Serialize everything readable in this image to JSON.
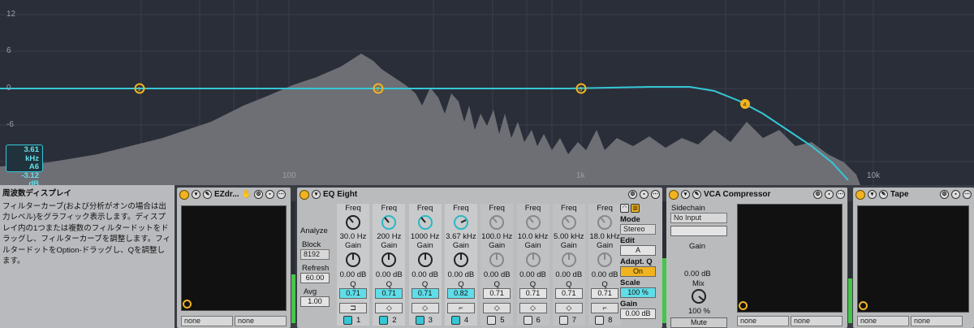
{
  "eq_display": {
    "db_labels": [
      "12",
      "6",
      "0",
      "-6"
    ],
    "freq_labels": [
      "100",
      "1k",
      "10k"
    ],
    "readout": {
      "freq": "3.61 kHz",
      "note": "A6",
      "gain": "-3.12 dB"
    },
    "points": [
      "1",
      "2",
      "3",
      "4"
    ]
  },
  "info": {
    "title": "周波数ディスプレイ",
    "body": "フィルターカーブ(および分析がオンの場合は出力レベル)をグラフィック表示します。ディスプレイ内の1つまたは複数のフィルタードットをドラッグし、フィルターカーブを調整します。フィルタードットをOption-ドラッグし、Qを調整します。"
  },
  "ezdrummer": {
    "name": "EZdr...",
    "routing": [
      "none",
      "none"
    ]
  },
  "eq_eight": {
    "name": "EQ Eight",
    "analyze": "Analyze",
    "block_label": "Block",
    "block_value": "8192",
    "refresh_label": "Refresh",
    "refresh_value": "60.00",
    "avg_label": "Avg",
    "avg_value": "1.00",
    "bands": [
      {
        "freq": "30.0 Hz",
        "gain": "0.00 dB",
        "q": "0.71",
        "num": "1"
      },
      {
        "freq": "200 Hz",
        "gain": "0.00 dB",
        "q": "0.71",
        "num": "2"
      },
      {
        "freq": "1000 Hz",
        "gain": "0.00 dB",
        "q": "0.71",
        "num": "3"
      },
      {
        "freq": "3.67 kHz",
        "gain": "0.00 dB",
        "q": "0.82",
        "num": "4"
      },
      {
        "freq": "100.0 Hz",
        "gain": "0.00 dB",
        "q": "0.71",
        "num": "5"
      },
      {
        "freq": "10.0 kHz",
        "gain": "0.00 dB",
        "q": "0.71",
        "num": "6"
      },
      {
        "freq": "5.00 kHz",
        "gain": "0.00 dB",
        "q": "0.71",
        "num": "7"
      },
      {
        "freq": "18.0 kHz",
        "gain": "0.00 dB",
        "q": "0.71",
        "num": "8"
      }
    ],
    "freq_label": "Freq",
    "gain_label": "Gain",
    "q_label": "Q",
    "mode_label": "Mode",
    "mode_value": "Stereo",
    "edit_label": "Edit",
    "edit_value": "A",
    "adaptq_label": "Adapt. Q",
    "adaptq_value": "On",
    "scale_label": "Scale",
    "scale_value": "100 %",
    "gain_label2": "Gain",
    "gain_value": "0.00 dB"
  },
  "vca": {
    "name": "VCA Compressor",
    "sidechain": "Sidechain",
    "input": "No Input",
    "gain_label": "Gain",
    "gain_value": "0.00 dB",
    "mix_label": "Mix",
    "mix_value": "100 %",
    "mute": "Mute",
    "routing": [
      "none",
      "none"
    ]
  },
  "tape": {
    "name": "Tape",
    "routing": [
      "none",
      "none"
    ]
  },
  "colors": {
    "accent": "#35c7d6",
    "orange": "#f1b320"
  }
}
